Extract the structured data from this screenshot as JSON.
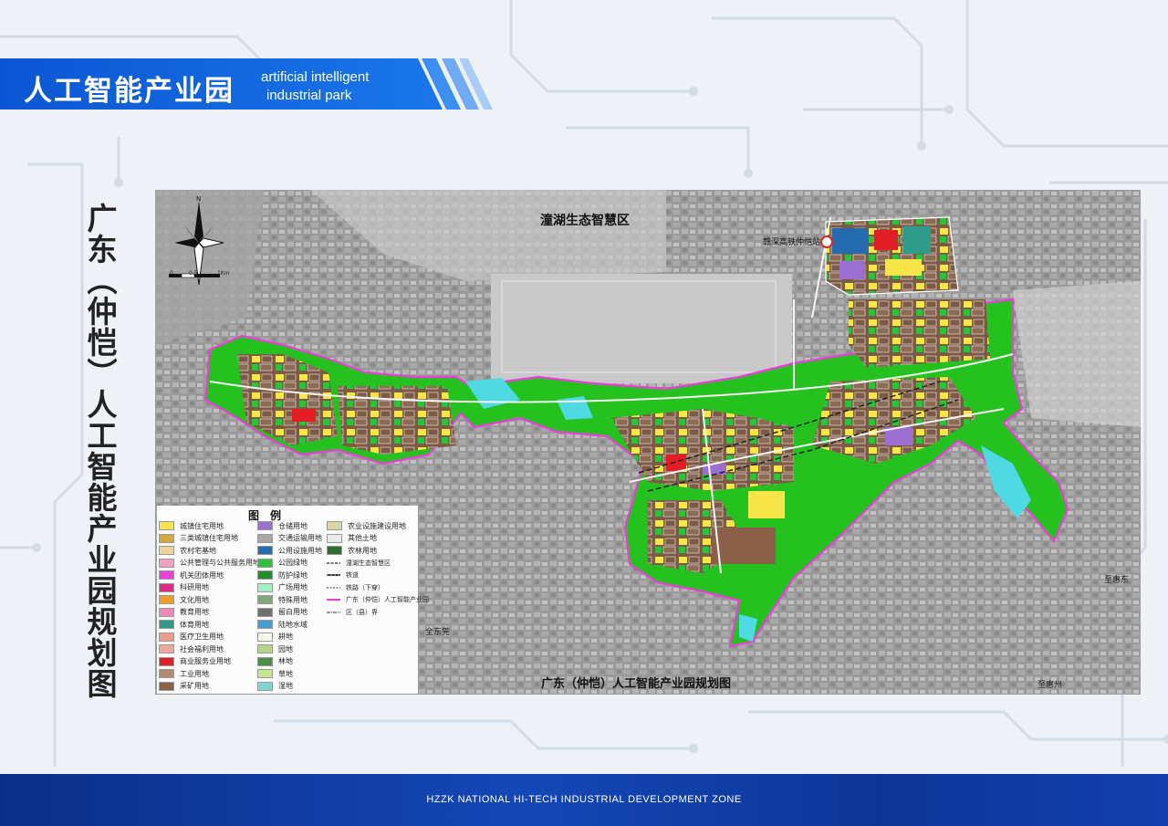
{
  "header": {
    "title_cn": "人工智能产业园",
    "title_en_line1": "artificial intelligent",
    "title_en_line2": "industrial park"
  },
  "side_title": "广东（仲恺）人工智能产业园规划图",
  "map": {
    "zone_label": "潼湖生态智慧区",
    "station_label": "赣深高铁仲恺站",
    "caption": "广东（仲恺）人工智能产业园规划图",
    "places": {
      "p1": "全东莞",
      "p2": "至惠州",
      "p3": "至惠东"
    },
    "scale": {
      "s0": "0",
      "s1": "0.5",
      "s2": "1Km"
    },
    "north": "N"
  },
  "legend": {
    "title": "图　例",
    "items": [
      {
        "label": "城镇住宅用地",
        "color": "#f7e64a"
      },
      {
        "label": "三类城镇住宅用地",
        "color": "#d8a83a"
      },
      {
        "label": "农村宅基地",
        "color": "#f1d59c"
      },
      {
        "label": "公共管理与公共服务用地",
        "color": "#f3a2c4"
      },
      {
        "label": "机关团体用地",
        "color": "#ee3ddc"
      },
      {
        "label": "科研用地",
        "color": "#e0288a"
      },
      {
        "label": "文化用地",
        "color": "#f49d26"
      },
      {
        "label": "教育用地",
        "color": "#f287bd"
      },
      {
        "label": "体育用地",
        "color": "#2e9b8b"
      },
      {
        "label": "医疗卫生用地",
        "color": "#f39a8a"
      },
      {
        "label": "社会福利用地",
        "color": "#f2a79e"
      },
      {
        "label": "商业服务业用地",
        "color": "#e31d25"
      },
      {
        "label": "工业用地",
        "color": "#b58b6b"
      },
      {
        "label": "采矿用地",
        "color": "#8a6148"
      },
      {
        "label": "仓储用地",
        "color": "#9b6fd1"
      },
      {
        "label": "交通运输用地",
        "color": "#a8a8a8"
      },
      {
        "label": "公用设施用地",
        "color": "#246bb0"
      },
      {
        "label": "公园绿地",
        "color": "#2ac33a"
      },
      {
        "label": "防护绿地",
        "color": "#1e8f2a"
      },
      {
        "label": "广场用地",
        "color": "#a6f2c6"
      },
      {
        "label": "特殊用地",
        "color": "#84a77f"
      },
      {
        "label": "留白用地",
        "color": "#6f6f6f"
      },
      {
        "label": "陆地水域",
        "color": "#4a9bd8"
      },
      {
        "label": "耕地",
        "color": "#fbfbe8"
      },
      {
        "label": "园地",
        "color": "#b4d98a"
      },
      {
        "label": "林地",
        "color": "#4a8e45"
      },
      {
        "label": "草地",
        "color": "#c6e98c"
      },
      {
        "label": "湿地",
        "color": "#7fd8cf"
      },
      {
        "label": "农业设施建设用地",
        "color": "#d9d7a6"
      },
      {
        "label": "其他土地",
        "color": "#ededed"
      },
      {
        "label": "农林用地",
        "color": "#2d6b2c"
      }
    ],
    "lines": [
      {
        "label": "潼湖生态智慧区",
        "style": "eco"
      },
      {
        "label": "铁道",
        "style": "rail"
      },
      {
        "label": "铁路（下穿）",
        "style": "rail-under"
      },
      {
        "label": "广东（仲恺）人工智能产业园",
        "style": "park"
      },
      {
        "label": "区（县）界",
        "style": "district"
      }
    ]
  },
  "footer": {
    "text": "HZZK NATIONAL HI-TECH INDUSTRIAL DEVELOPMENT ZONE"
  }
}
